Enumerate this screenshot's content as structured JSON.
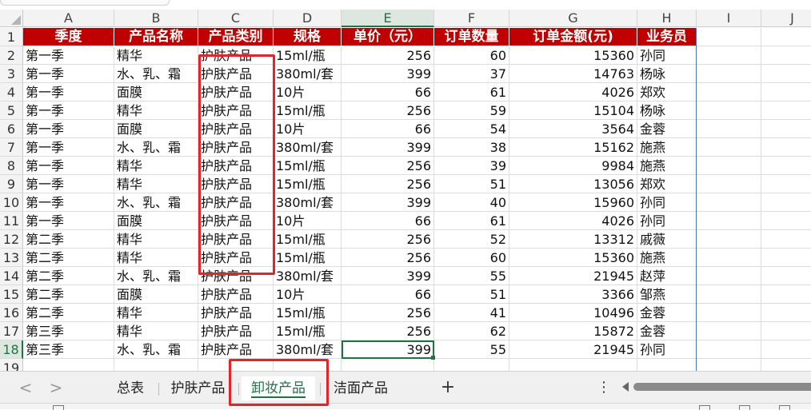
{
  "columns": [
    "A",
    "B",
    "C",
    "D",
    "E",
    "F",
    "G",
    "H",
    "I",
    "J"
  ],
  "selected_column": "E",
  "header": [
    "季度",
    "产品名称",
    "产品类别",
    "规格",
    "单价（元）",
    "订单数量",
    "订单金额(元)",
    "业务员"
  ],
  "rows": [
    [
      "第一季",
      "精华",
      "护肤产品",
      "15ml/瓶",
      "256",
      "60",
      "15360",
      "孙同"
    ],
    [
      "第一季",
      "水、乳、霜",
      "护肤产品",
      "380ml/套",
      "399",
      "37",
      "14763",
      "杨咏"
    ],
    [
      "第一季",
      "面膜",
      "护肤产品",
      "10片",
      "66",
      "61",
      "4026",
      "郑欢"
    ],
    [
      "第一季",
      "精华",
      "护肤产品",
      "15ml/瓶",
      "256",
      "59",
      "15104",
      "杨咏"
    ],
    [
      "第一季",
      "面膜",
      "护肤产品",
      "10片",
      "66",
      "54",
      "3564",
      "金蓉"
    ],
    [
      "第一季",
      "水、乳、霜",
      "护肤产品",
      "380ml/套",
      "399",
      "38",
      "15162",
      "施燕"
    ],
    [
      "第一季",
      "精华",
      "护肤产品",
      "15ml/瓶",
      "256",
      "39",
      "9984",
      "施燕"
    ],
    [
      "第一季",
      "精华",
      "护肤产品",
      "15ml/瓶",
      "256",
      "51",
      "13056",
      "郑欢"
    ],
    [
      "第一季",
      "水、乳、霜",
      "护肤产品",
      "380ml/套",
      "399",
      "40",
      "15960",
      "孙同"
    ],
    [
      "第一季",
      "面膜",
      "护肤产品",
      "10片",
      "66",
      "61",
      "4026",
      "孙同"
    ],
    [
      "第二季",
      "精华",
      "护肤产品",
      "15ml/瓶",
      "256",
      "52",
      "13312",
      "戚薇"
    ],
    [
      "第二季",
      "精华",
      "护肤产品",
      "15ml/瓶",
      "256",
      "60",
      "15360",
      "施燕"
    ],
    [
      "第二季",
      "水、乳、霜",
      "护肤产品",
      "380ml/套",
      "399",
      "55",
      "21945",
      "赵萍"
    ],
    [
      "第二季",
      "面膜",
      "护肤产品",
      "10片",
      "66",
      "51",
      "3366",
      "邹燕"
    ],
    [
      "第二季",
      "精华",
      "护肤产品",
      "15ml/瓶",
      "256",
      "41",
      "10496",
      "金蓉"
    ],
    [
      "第三季",
      "精华",
      "护肤产品",
      "15ml/瓶",
      "256",
      "62",
      "15872",
      "金蓉"
    ],
    [
      "第三季",
      "水、乳、霜",
      "护肤产品",
      "380ml/套",
      "399",
      "55",
      "21945",
      "孙同"
    ]
  ],
  "row_numbers": [
    "1",
    "2",
    "3",
    "4",
    "5",
    "6",
    "7",
    "8",
    "9",
    "10",
    "11",
    "12",
    "13",
    "14",
    "15",
    "16",
    "17",
    "18",
    "19"
  ],
  "selected_row": "18",
  "active_cell": "E18",
  "sheet_tabs": [
    "总表",
    "护肤产品",
    "卸妆产品",
    "洁面产品"
  ],
  "active_tab": "卸妆产品",
  "add_sheet_label": "+",
  "more_label": "⋮",
  "nav_prev": "<",
  "nav_next": ">",
  "colors": {
    "header_fill": "#c00000",
    "accent": "#217346",
    "highlight_box": "#e0252b"
  }
}
